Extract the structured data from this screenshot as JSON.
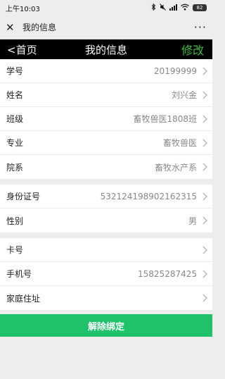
{
  "status_bar": {
    "time": "上午10:03",
    "battery": "82"
  },
  "wechat_bar": {
    "close_glyph": "✕",
    "title": "我的信息",
    "more_glyph": "···"
  },
  "header": {
    "back_label": "<首页",
    "title": "我的信息",
    "edit_label": "修改",
    "edit_color": "#3bba3b"
  },
  "group_basic": [
    {
      "label": "学号",
      "value": "20199999"
    },
    {
      "label": "姓名",
      "value": "刘兴金"
    },
    {
      "label": "班级",
      "value": "畜牧兽医1808班"
    },
    {
      "label": "专业",
      "value": "畜牧兽医"
    },
    {
      "label": "院系",
      "value": "畜牧水产系"
    }
  ],
  "group_identity": [
    {
      "label": "身份证号",
      "value": "532124198902162315"
    },
    {
      "label": "性别",
      "value": "男"
    }
  ],
  "group_contact": [
    {
      "label": "卡号",
      "value": ""
    },
    {
      "label": "手机号",
      "value": "15825287425"
    },
    {
      "label": "家庭住址",
      "value": ""
    }
  ],
  "unbind_button": {
    "label": "解除绑定",
    "color": "#1fc16b"
  }
}
